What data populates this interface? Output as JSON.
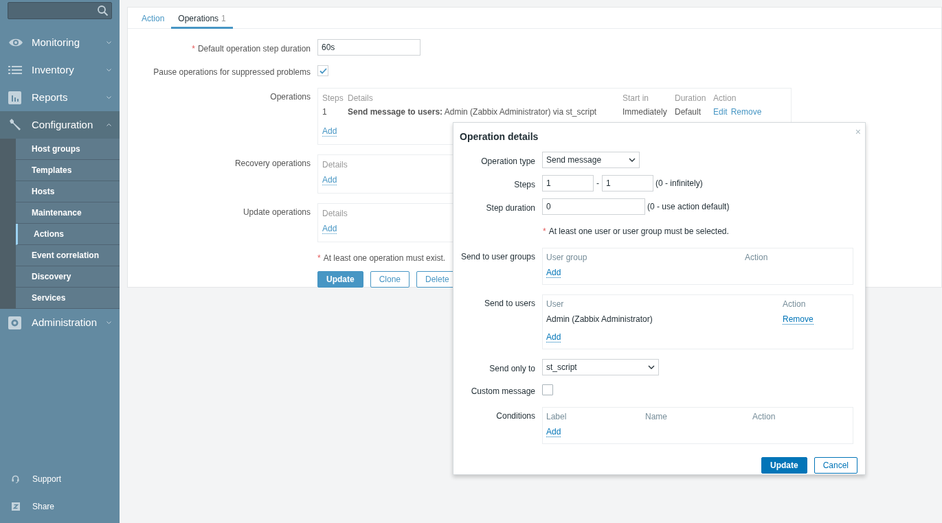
{
  "sidebar": {
    "menu": [
      {
        "label": "Monitoring",
        "expanded": false
      },
      {
        "label": "Inventory",
        "expanded": false
      },
      {
        "label": "Reports",
        "expanded": false
      },
      {
        "label": "Configuration",
        "expanded": true,
        "children": [
          {
            "label": "Host groups",
            "selected": false
          },
          {
            "label": "Templates",
            "selected": false
          },
          {
            "label": "Hosts",
            "selected": false
          },
          {
            "label": "Maintenance",
            "selected": false
          },
          {
            "label": "Actions",
            "selected": true
          },
          {
            "label": "Event correlation",
            "selected": false
          },
          {
            "label": "Discovery",
            "selected": false
          },
          {
            "label": "Services",
            "selected": false
          }
        ]
      },
      {
        "label": "Administration",
        "expanded": false
      }
    ],
    "footer": [
      "Support",
      "Share"
    ]
  },
  "tabs": [
    {
      "label": "Action",
      "selected": false
    },
    {
      "label": "Operations",
      "count": "1",
      "selected": true
    }
  ],
  "form": {
    "step_duration": {
      "label": "Default operation step duration",
      "marker": "*",
      "value": "60s"
    },
    "pause": {
      "label": "Pause operations for suppressed problems",
      "checked": true
    },
    "operations": {
      "label": "Operations",
      "columns": [
        "Steps",
        "Details",
        "Start in",
        "Duration",
        "Action"
      ],
      "rows": [
        {
          "steps": "1",
          "details_bold": "Send message to users:",
          "details": "Admin (Zabbix Administrator) via st_script",
          "start_in": "Immediately",
          "duration": "Default",
          "actions": [
            "Edit",
            "Remove"
          ]
        }
      ],
      "add": "Add"
    },
    "recovery_operations": {
      "label": "Recovery operations",
      "columns": [
        "Details"
      ],
      "add": "Add"
    },
    "update_operations": {
      "label": "Update operations",
      "columns": [
        "Details"
      ],
      "add": "Add"
    },
    "note": {
      "marker": "*",
      "text": "At least one operation must exist."
    },
    "buttons": [
      {
        "label": "Update",
        "primary": true
      },
      {
        "label": "Clone",
        "primary": false
      },
      {
        "label": "Delete",
        "primary": false
      }
    ]
  },
  "dialog": {
    "title": "Operation details",
    "close": "×",
    "operation_type": {
      "label": "Operation type",
      "value": "Send message"
    },
    "steps": {
      "label": "Steps",
      "from": "1",
      "separator": "-",
      "to": "1",
      "hint": "(0 - infinitely)"
    },
    "step_duration": {
      "label": "Step duration",
      "value": "0",
      "hint": "(0 - use action default)"
    },
    "note": {
      "marker": "*",
      "text": "At least one user or user group must be selected."
    },
    "user_groups": {
      "label": "Send to user groups",
      "columns": [
        "User group",
        "Action"
      ],
      "add": "Add"
    },
    "users": {
      "label": "Send to users",
      "columns": [
        "User",
        "Action"
      ],
      "rows": [
        {
          "name": "Admin (Zabbix Administrator)",
          "action": "Remove"
        }
      ],
      "add": "Add"
    },
    "send_only_to": {
      "label": "Send only to",
      "value": "st_script"
    },
    "custom_message": {
      "label": "Custom message",
      "checked": false
    },
    "conditions": {
      "label": "Conditions",
      "columns": [
        "Label",
        "Name",
        "Action"
      ],
      "add": "Add"
    },
    "buttons": [
      {
        "label": "Update",
        "primary": true
      },
      {
        "label": "Cancel",
        "primary": false
      }
    ]
  }
}
